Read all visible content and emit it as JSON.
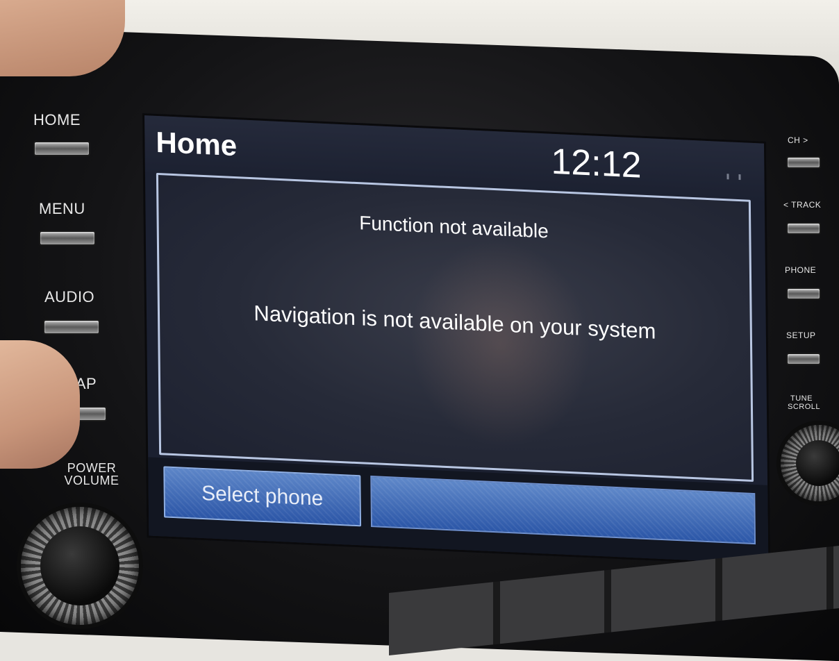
{
  "left_buttons": [
    {
      "label": "HOME"
    },
    {
      "label": "MENU"
    },
    {
      "label": "AUDIO"
    },
    {
      "label": "MAP"
    }
  ],
  "power_volume": {
    "line1": "POWER",
    "line2": "VOLUME"
  },
  "right_buttons": [
    {
      "label": "CH >"
    },
    {
      "label": "< TRACK"
    },
    {
      "label": "PHONE"
    },
    {
      "label": "SETUP"
    }
  ],
  "tune_scroll": {
    "line1": "TUNE",
    "line2": "SCROLL"
  },
  "screen": {
    "title": "Home",
    "clock": "12:12",
    "dialog": {
      "title": "Function not available",
      "message": "Navigation is not available on your system"
    },
    "bottom_bar": {
      "select_phone_label": "Select phone"
    }
  },
  "colors": {
    "button_blue": "#3b66b3",
    "dialog_border": "#b8c6e2",
    "screen_bg": "#1b2030"
  }
}
